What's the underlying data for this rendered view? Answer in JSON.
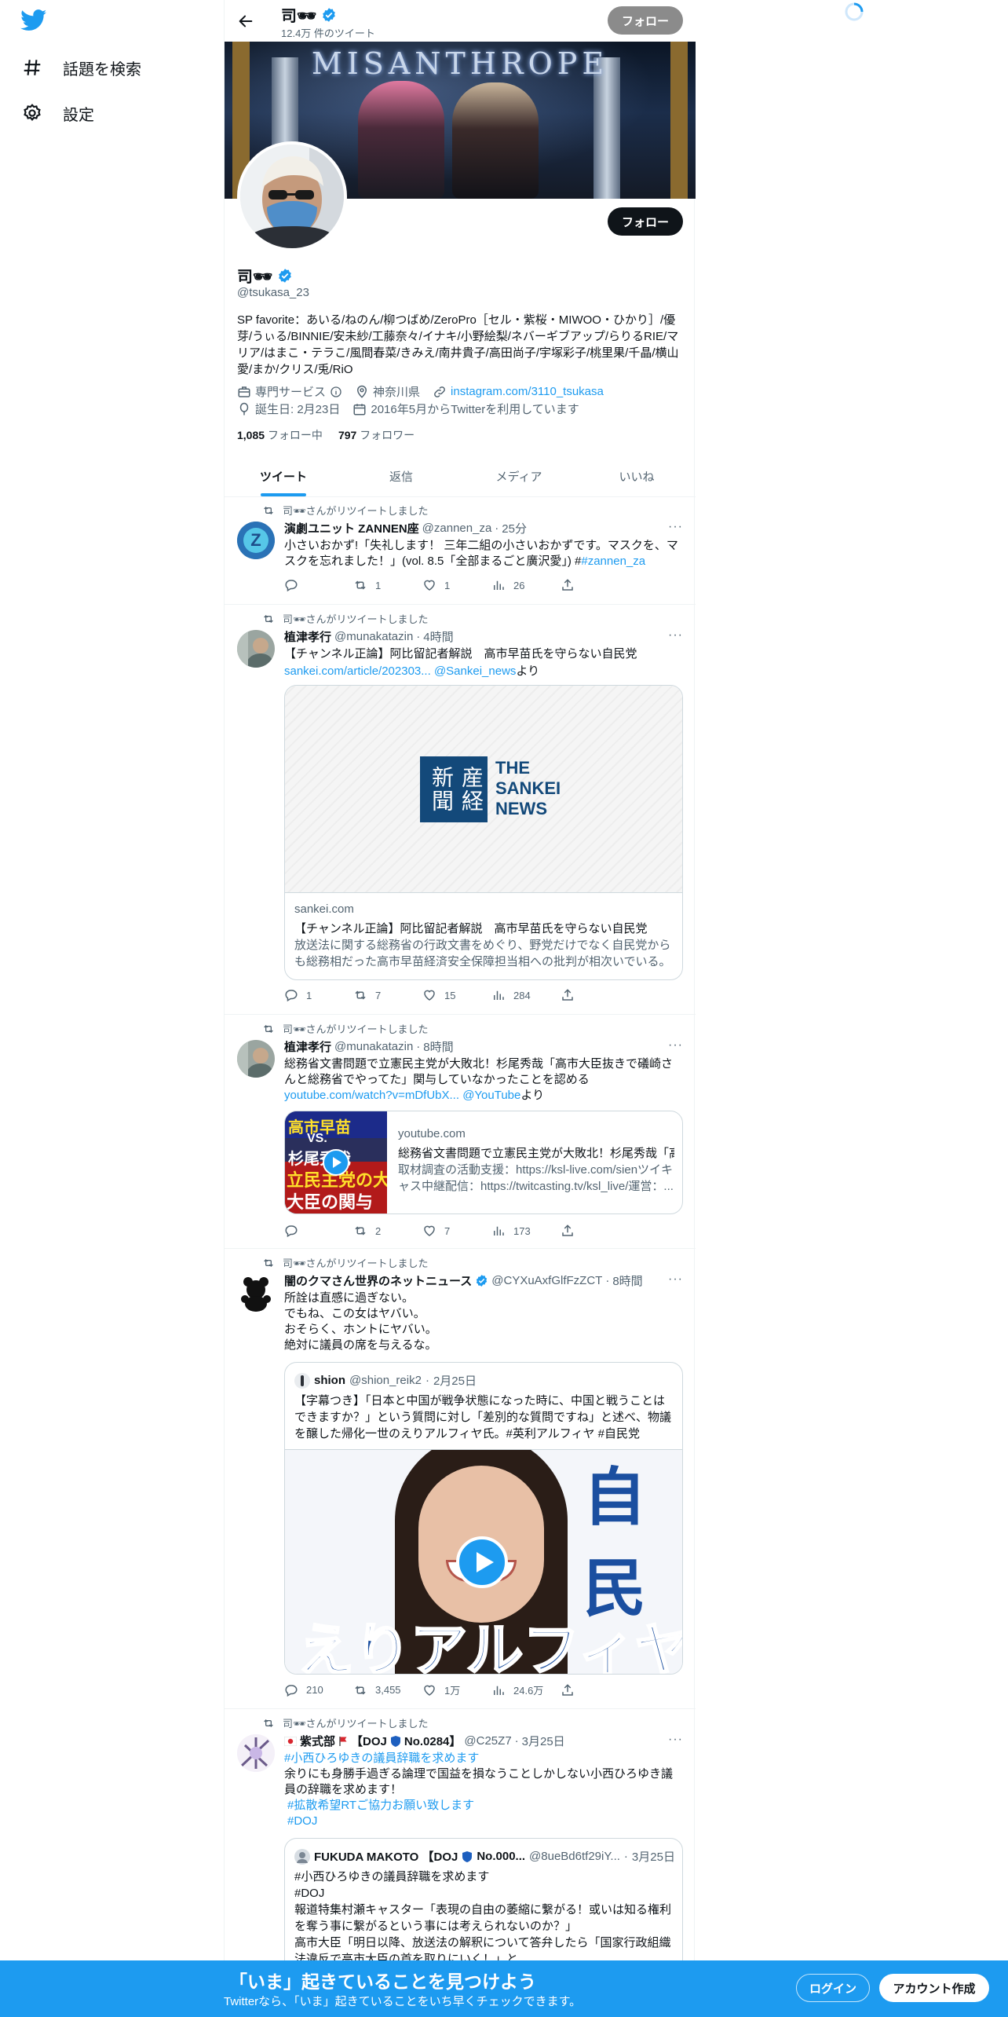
{
  "sidebar": {
    "explore_label": "話題を検索",
    "settings_label": "設定"
  },
  "header": {
    "name": "司🕶",
    "tweet_count": "12.4万 件のツイート",
    "follow_label": "フォロー"
  },
  "banner": {
    "text": "MISANTHROPE"
  },
  "profile": {
    "name": "司🕶",
    "handle": "@tsukasa_23",
    "follow_label": "フォロー",
    "bio": "SP favorite：あいる/ねのん/柳つばめ/ZeroPro［セル・紫桜・MIWOO・ひかり］/優芽/うぃる/BINNIE/安未紗/工藤奈々/イナキ/小野絵梨/ネバーギブアップ/らりるRIE/マリア/はまこ・テラこ/風間春菜/きみえ/南井貴子/高田尚子/宇塚彩子/桃里果/千晶/横山愛/まか/クリス/兎/RiO",
    "category": "専門サービス",
    "location": "神奈川県",
    "website": "instagram.com/3110_tsukasa",
    "birthday": "誕生日: 2月23日",
    "joined": "2016年5月からTwitterを利用しています",
    "following_count": "1,085",
    "following_label": "フォロー中",
    "followers_count": "797",
    "followers_label": "フォロワー"
  },
  "tabs": [
    {
      "label": "ツイート"
    },
    {
      "label": "返信"
    },
    {
      "label": "メディア"
    },
    {
      "label": "いいね"
    }
  ],
  "retweet_label": "司🕶さんがリツイートしました",
  "tweets": [
    {
      "name": "演劇ユニット ZANNEN座",
      "handle": "@zannen_za",
      "time": "25分",
      "text": "小さいおかず!「失礼します！ 三年二組の小さいおかずです。マスクを、マスクを忘れました！」(vol. 8.5「全部まるごと廣沢愛」) #",
      "hashtag": "#zannen_za",
      "replies": "",
      "retweets": "1",
      "likes": "1",
      "views": "26"
    },
    {
      "name": "植津孝行",
      "handle": "@munakatazin",
      "time": "4時間",
      "text": "【チャンネル正論】阿比留記者解説　高市早苗氏を守らない自民党",
      "link": "sankei.com/article/202303...",
      "mention": "@Sankei_news",
      "link_suffix": "より",
      "card_logo_en": "THE SANKEI NEWS",
      "card_logo_jp": "産経新聞",
      "card_domain": "sankei.com",
      "card_title": "【チャンネル正論】阿比留記者解説　高市早苗氏を守らない自民党",
      "card_desc": "放送法に関する総務省の行政文書をめぐり、野党だけでなく自民党からも総務相だった高市早苗経済安全保障担当相への批判が相次いでいる。",
      "replies": "1",
      "retweets": "7",
      "likes": "15",
      "views": "284"
    },
    {
      "name": "植津孝行",
      "handle": "@munakatazin",
      "time": "8時間",
      "text": "総務省文書問題で立憲民主党が大敗北！杉尾秀哉「高市大臣抜きで礒崎さんと総務省でやってた」関与していなかったことを認める",
      "link": "youtube.com/watch?v=mDfUbX...",
      "mention": "@YouTube",
      "link_suffix": "より",
      "card_domain": "youtube.com",
      "card_title": "総務省文書問題で立憲民主党が大敗北！杉尾秀哉「高市大臣抜...",
      "card_desc": "取材調査の活動支援：https://ksl-live.com/sienツイキャス中継配信：https://twitcasting.tv/ksl_live/運営：...",
      "thumb_top": "高市早苗",
      "thumb_vs": "VS.",
      "thumb_mid": "杉尾秀哉",
      "thumb_l1": "立民主党の大",
      "thumb_l2": "大臣の関与",
      "replies": "",
      "retweets": "2",
      "likes": "7",
      "views": "173"
    },
    {
      "name": "闇のクマさん世界のネットニュース",
      "handle": "@CYXuAxfGlfFzZCT",
      "time": "8時間",
      "text": "所詮は直感に過ぎない。\nでもね、この女はヤバい。\nおそらく、ホントにヤバい。\n絶対に議員の席を与えるな。",
      "quote_name": "shion",
      "quote_handle": "@shion_reik2",
      "quote_time": "2月25日",
      "quote_text": "【字幕つき】「日本と中国が戦争状態になった時に、中国と戦うことはできますか？」という質問に対し「差別的な質問ですね」と述べ、物議を醸した帰化一世のえりアルフィヤ氏。#英利アルフィヤ #自民党",
      "video_caption": "えりアルフィヤ",
      "video_corner": "自民",
      "replies": "210",
      "retweets": "3,455",
      "likes": "1万",
      "views": "24.6万"
    },
    {
      "name": "紫式部",
      "name_tail": "【DOJ",
      "name_tail2": "No.0284】",
      "handle": "@C25Z7",
      "time": "3月25日",
      "tag1": "#小西ひろゆきの議員辞職を求めます",
      "text": "余りにも身勝手過ぎる論理で国益を損なうことしかしない小西ひろゆき議員の辞職を求めます！",
      "tag2": "#拡散希望RTご協力お願い致します",
      "tag3": "#DOJ",
      "quote_name": "FUKUDA MAKOTO 【DOJ",
      "quote_name_tail": "No.000...",
      "quote_handle": "@8ueBd6tf29iY...",
      "quote_time": "3月25日",
      "quote_text": "#小西ひろゆきの議員辞職を求めます\n#DOJ\n報道特集村瀬キャスター「表現の自由の萎縮に繋がる！或いは知る権利を奪う事に繋がるという事には考えられないのか？」\n高市大臣「明日以降、放送法の解釈について答弁したら「国家行政組織法違反で高市大臣の首を取りにいく！」と...."
    }
  ],
  "bottom_bar": {
    "headline": "「いま」起きていることを見つけよう",
    "subline": "Twitterなら、「いま」起きていることをいち早くチェックできます。",
    "login_label": "ログイン",
    "signup_label": "アカウント作成"
  },
  "colors": {
    "accent": "#1d9bf0",
    "bottom_bar": "#1d9bf0",
    "text": "#0f1419",
    "secondary": "#536471"
  }
}
